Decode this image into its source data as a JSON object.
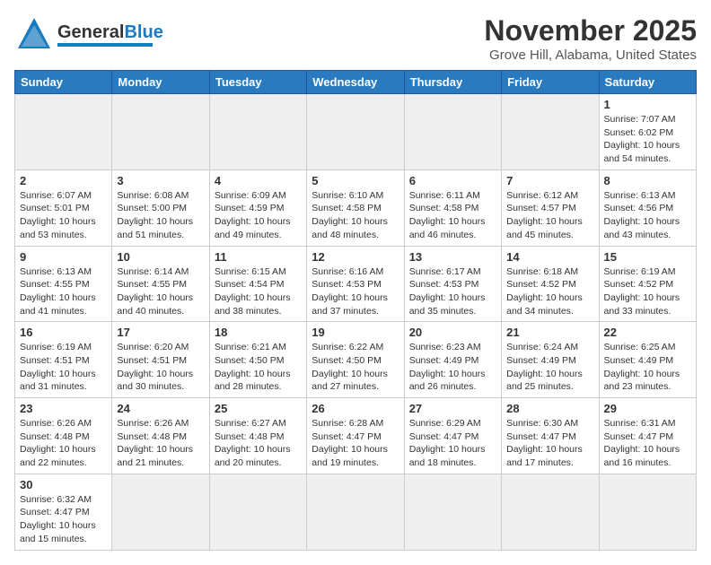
{
  "header": {
    "logo_general": "General",
    "logo_blue": "Blue",
    "month_title": "November 2025",
    "location": "Grove Hill, Alabama, United States"
  },
  "weekdays": [
    "Sunday",
    "Monday",
    "Tuesday",
    "Wednesday",
    "Thursday",
    "Friday",
    "Saturday"
  ],
  "weeks": [
    [
      {
        "day": "",
        "info": ""
      },
      {
        "day": "",
        "info": ""
      },
      {
        "day": "",
        "info": ""
      },
      {
        "day": "",
        "info": ""
      },
      {
        "day": "",
        "info": ""
      },
      {
        "day": "",
        "info": ""
      },
      {
        "day": "1",
        "info": "Sunrise: 7:07 AM\nSunset: 6:02 PM\nDaylight: 10 hours\nand 54 minutes."
      }
    ],
    [
      {
        "day": "2",
        "info": "Sunrise: 6:07 AM\nSunset: 5:01 PM\nDaylight: 10 hours\nand 53 minutes."
      },
      {
        "day": "3",
        "info": "Sunrise: 6:08 AM\nSunset: 5:00 PM\nDaylight: 10 hours\nand 51 minutes."
      },
      {
        "day": "4",
        "info": "Sunrise: 6:09 AM\nSunset: 4:59 PM\nDaylight: 10 hours\nand 49 minutes."
      },
      {
        "day": "5",
        "info": "Sunrise: 6:10 AM\nSunset: 4:58 PM\nDaylight: 10 hours\nand 48 minutes."
      },
      {
        "day": "6",
        "info": "Sunrise: 6:11 AM\nSunset: 4:58 PM\nDaylight: 10 hours\nand 46 minutes."
      },
      {
        "day": "7",
        "info": "Sunrise: 6:12 AM\nSunset: 4:57 PM\nDaylight: 10 hours\nand 45 minutes."
      },
      {
        "day": "8",
        "info": "Sunrise: 6:13 AM\nSunset: 4:56 PM\nDaylight: 10 hours\nand 43 minutes."
      }
    ],
    [
      {
        "day": "9",
        "info": "Sunrise: 6:13 AM\nSunset: 4:55 PM\nDaylight: 10 hours\nand 41 minutes."
      },
      {
        "day": "10",
        "info": "Sunrise: 6:14 AM\nSunset: 4:55 PM\nDaylight: 10 hours\nand 40 minutes."
      },
      {
        "day": "11",
        "info": "Sunrise: 6:15 AM\nSunset: 4:54 PM\nDaylight: 10 hours\nand 38 minutes."
      },
      {
        "day": "12",
        "info": "Sunrise: 6:16 AM\nSunset: 4:53 PM\nDaylight: 10 hours\nand 37 minutes."
      },
      {
        "day": "13",
        "info": "Sunrise: 6:17 AM\nSunset: 4:53 PM\nDaylight: 10 hours\nand 35 minutes."
      },
      {
        "day": "14",
        "info": "Sunrise: 6:18 AM\nSunset: 4:52 PM\nDaylight: 10 hours\nand 34 minutes."
      },
      {
        "day": "15",
        "info": "Sunrise: 6:19 AM\nSunset: 4:52 PM\nDaylight: 10 hours\nand 33 minutes."
      }
    ],
    [
      {
        "day": "16",
        "info": "Sunrise: 6:19 AM\nSunset: 4:51 PM\nDaylight: 10 hours\nand 31 minutes."
      },
      {
        "day": "17",
        "info": "Sunrise: 6:20 AM\nSunset: 4:51 PM\nDaylight: 10 hours\nand 30 minutes."
      },
      {
        "day": "18",
        "info": "Sunrise: 6:21 AM\nSunset: 4:50 PM\nDaylight: 10 hours\nand 28 minutes."
      },
      {
        "day": "19",
        "info": "Sunrise: 6:22 AM\nSunset: 4:50 PM\nDaylight: 10 hours\nand 27 minutes."
      },
      {
        "day": "20",
        "info": "Sunrise: 6:23 AM\nSunset: 4:49 PM\nDaylight: 10 hours\nand 26 minutes."
      },
      {
        "day": "21",
        "info": "Sunrise: 6:24 AM\nSunset: 4:49 PM\nDaylight: 10 hours\nand 25 minutes."
      },
      {
        "day": "22",
        "info": "Sunrise: 6:25 AM\nSunset: 4:49 PM\nDaylight: 10 hours\nand 23 minutes."
      }
    ],
    [
      {
        "day": "23",
        "info": "Sunrise: 6:26 AM\nSunset: 4:48 PM\nDaylight: 10 hours\nand 22 minutes."
      },
      {
        "day": "24",
        "info": "Sunrise: 6:26 AM\nSunset: 4:48 PM\nDaylight: 10 hours\nand 21 minutes."
      },
      {
        "day": "25",
        "info": "Sunrise: 6:27 AM\nSunset: 4:48 PM\nDaylight: 10 hours\nand 20 minutes."
      },
      {
        "day": "26",
        "info": "Sunrise: 6:28 AM\nSunset: 4:47 PM\nDaylight: 10 hours\nand 19 minutes."
      },
      {
        "day": "27",
        "info": "Sunrise: 6:29 AM\nSunset: 4:47 PM\nDaylight: 10 hours\nand 18 minutes."
      },
      {
        "day": "28",
        "info": "Sunrise: 6:30 AM\nSunset: 4:47 PM\nDaylight: 10 hours\nand 17 minutes."
      },
      {
        "day": "29",
        "info": "Sunrise: 6:31 AM\nSunset: 4:47 PM\nDaylight: 10 hours\nand 16 minutes."
      }
    ],
    [
      {
        "day": "30",
        "info": "Sunrise: 6:32 AM\nSunset: 4:47 PM\nDaylight: 10 hours\nand 15 minutes."
      },
      {
        "day": "",
        "info": ""
      },
      {
        "day": "",
        "info": ""
      },
      {
        "day": "",
        "info": ""
      },
      {
        "day": "",
        "info": ""
      },
      {
        "day": "",
        "info": ""
      },
      {
        "day": "",
        "info": ""
      }
    ]
  ]
}
